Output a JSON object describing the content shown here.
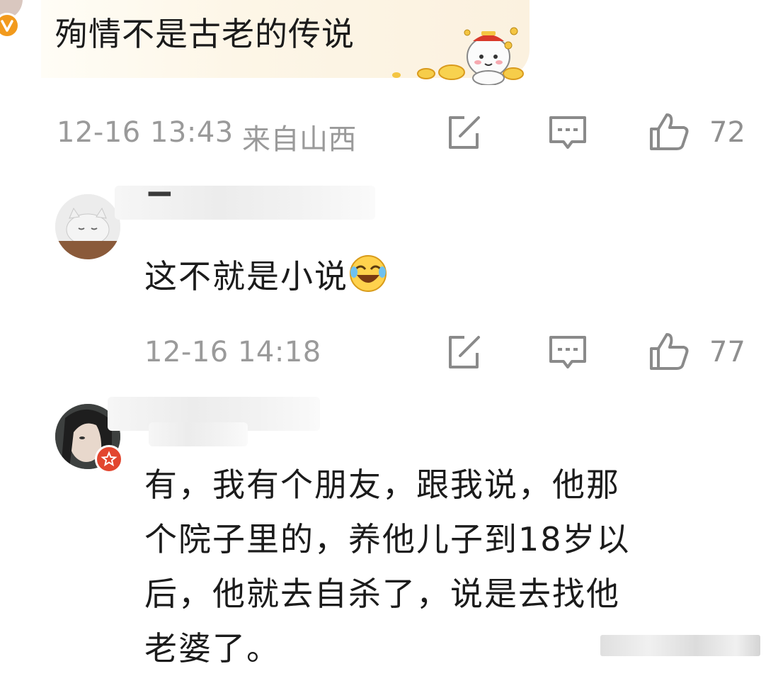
{
  "comments": [
    {
      "text": "殉情不是古老的传说",
      "date": "12-16 13:43",
      "location": "来自山西",
      "likes": "72"
    },
    {
      "text": "这不就是小说",
      "date": "12-16 14:18",
      "likes": "77"
    },
    {
      "text_lines": [
        "有，我有个朋友，跟我说，他那",
        "个院子里的，养他儿子到18岁以",
        "后，他就去自杀了，说是去找他",
        "老婆了。"
      ]
    }
  ],
  "icons": {
    "share": "share-edit-icon",
    "comment": "comment-icon",
    "like": "thumbs-up-icon",
    "laugh_emoji": "laugh-cry-emoji",
    "vip": "vip-badge-icon"
  },
  "colors": {
    "meta_text": "#9a9a9a",
    "vip_orange": "#f29a1d",
    "badge_red": "#e2462f"
  }
}
